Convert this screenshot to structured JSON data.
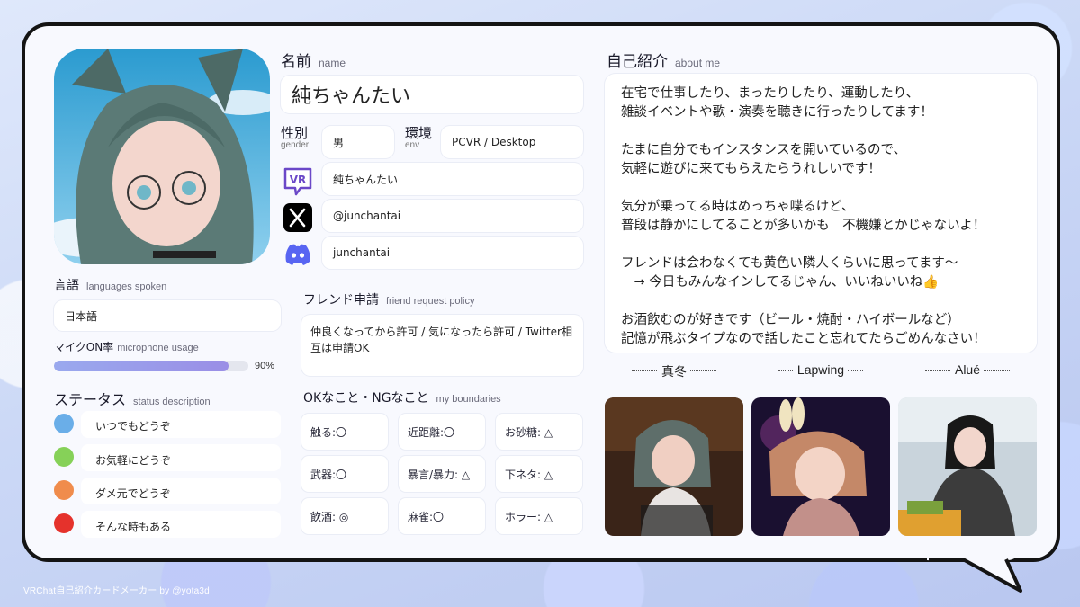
{
  "name_section": {
    "title": "名前",
    "title_en": "name",
    "value": "純ちゃんたい"
  },
  "gender": {
    "label": "性別",
    "label_en": "gender",
    "value": "男"
  },
  "env": {
    "label": "環境",
    "label_en": "env",
    "value": "PCVR / Desktop"
  },
  "accounts": [
    {
      "icon": "vrchat-icon",
      "value": "純ちゃんたい"
    },
    {
      "icon": "x-icon",
      "value": "@junchantai"
    },
    {
      "icon": "discord-icon",
      "value": "junchantai"
    }
  ],
  "languages": {
    "title": "言語",
    "title_en": "languages spoken",
    "value": "日本語"
  },
  "mic": {
    "title": "マイクON率",
    "title_en": "microphone usage",
    "percent_text": "90%",
    "percent": 90
  },
  "status": {
    "title": "ステータス",
    "title_en": "status description",
    "items": [
      {
        "color": "#6aaee8",
        "label": "いつでもどうぞ"
      },
      {
        "color": "#86d158",
        "label": "お気軽にどうぞ"
      },
      {
        "color": "#f08c4c",
        "label": "ダメ元でどうぞ"
      },
      {
        "color": "#e5322c",
        "label": "そんな時もある"
      }
    ]
  },
  "friend_request": {
    "title": "フレンド申請",
    "title_en": "friend request policy",
    "value": "仲良くなってから許可 / 気になったら許可 / Twitter相互は申請OK"
  },
  "boundaries": {
    "title": "OKなこと・NGなこと",
    "title_en": "my boundaries",
    "items": [
      "触る:〇",
      "近距離:〇",
      "お砂糖: △",
      "武器:〇",
      "暴言/暴力: △",
      "下ネタ: △",
      "飲酒: ◎",
      "麻雀:〇",
      "ホラー: △"
    ]
  },
  "about": {
    "title": "自己紹介",
    "title_en": "about me",
    "text": "在宅で仕事したり、まったりしたり、運動したり、\n雑談イベントや歌・演奏を聴きに行ったりしてます！\n\nたまに自分でもインスタンスを開いているので、\n気軽に遊びに来てもらえたらうれしいです！\n\n気分が乗ってる時はめっちゃ喋るけど、\n普段は静かにしてることが多いかも　不機嫌とかじゃないよ！\n\nフレンドは会わなくても黄色い隣人くらいに思ってます〜\n　→ 今日もみんなインしてるじゃん、いいねいいね👍\n\nお酒飲むのが好きです（ビール・焼酎・ハイボールなど）\n記憶が飛ぶタイプなので話したこと忘れてたらごめんなさい！"
  },
  "friends": [
    "真冬",
    "Lapwing",
    "Alué"
  ],
  "footer": "VRChat自己紹介カードメーカー by @yota3d"
}
